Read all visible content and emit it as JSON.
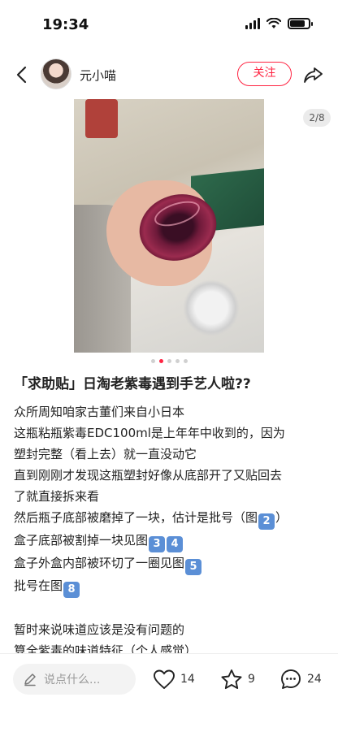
{
  "status_bar": {
    "time": "19:34"
  },
  "header": {
    "author_name": "元小喵",
    "follow_label": "关注"
  },
  "media": {
    "page_indicator": "2/8",
    "current_page": 2,
    "dot_count": 5
  },
  "post": {
    "title": "「求助贴」日淘老紫毒遇到手艺人啦??",
    "lines": [
      "众所周知咱家古董们来自小日本",
      "这瓶粘瓶紫毒EDC100ml是上年年中收到的，因为",
      "塑封完整（看上去）就一直没动它",
      "直到刚刚才发现这瓶塑封好像从底部开了又贴回去",
      "了就直接拆来看",
      "然后瓶子底部被磨掉了一块，估计是批号（图",
      "盒子底部被割掉一块见图",
      "盒子外盒内部被环切了一圈见图",
      "批号在图",
      "",
      "暂时来说味道应该是没有问题的",
      "算全紫毒的味道特征（个人感觉）"
    ],
    "ref_numbers": [
      "2",
      "3",
      "4",
      "5",
      "8"
    ],
    "ref_close": "）"
  },
  "bottom_bar": {
    "comment_placeholder": "说点什么...",
    "likes": "14",
    "favorites": "9",
    "comments": "24"
  },
  "colors": {
    "accent": "#ff2442",
    "keycap": "#5b8fd6"
  }
}
